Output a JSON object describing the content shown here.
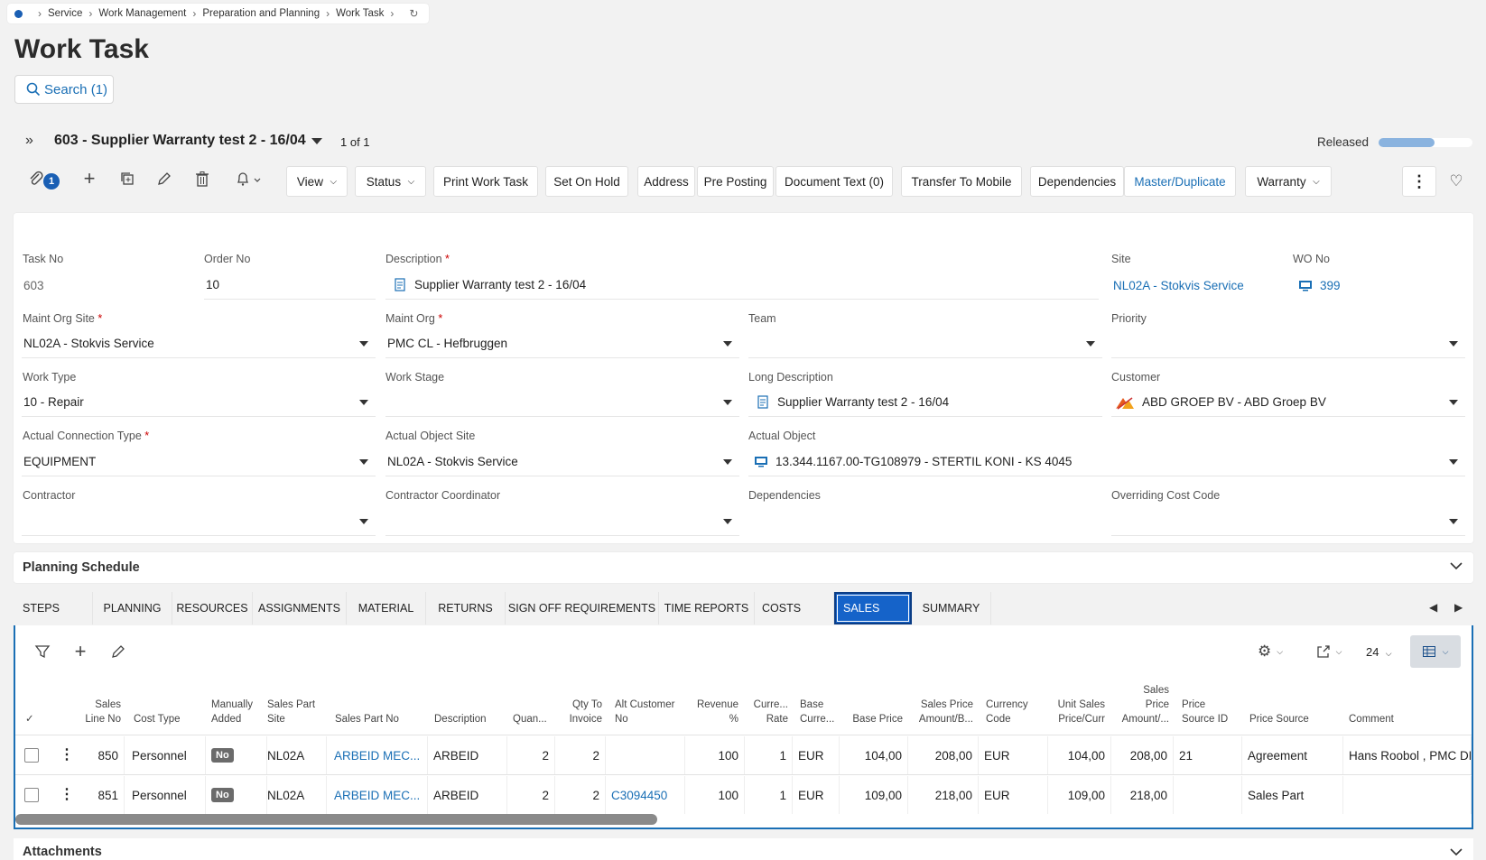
{
  "breadcrumb": [
    "Service",
    "Work Management",
    "Preparation and Planning",
    "Work Task"
  ],
  "page_title": "Work Task",
  "search_label": "Search (1)",
  "record": {
    "title": "603 - Supplier Warranty test 2 - 16/04",
    "count": "1 of 1",
    "status": "Released",
    "status_progress": 0.6
  },
  "toolbar": {
    "attachments_count": "1",
    "view": "View",
    "status": "Status",
    "print": "Print Work Task",
    "hold": "Set On Hold",
    "address": "Address",
    "pre_posting": "Pre Posting",
    "document_text": "Document Text (0)",
    "transfer": "Transfer To Mobile",
    "dependencies": "Dependencies",
    "master": "Master/Duplicate",
    "warranty": "Warranty"
  },
  "form": {
    "task_no": {
      "label": "Task No",
      "value": "603"
    },
    "order_no": {
      "label": "Order No",
      "value": "10"
    },
    "description": {
      "label": "Description",
      "value": "Supplier Warranty test 2 - 16/04"
    },
    "site": {
      "label": "Site",
      "value": "NL02A - Stokvis Service"
    },
    "wo_no": {
      "label": "WO No",
      "value": "399"
    },
    "maint_org_site": {
      "label": "Maint Org Site",
      "value": "NL02A - Stokvis Service"
    },
    "maint_org": {
      "label": "Maint Org",
      "value": "PMC CL - Hefbruggen"
    },
    "team": {
      "label": "Team",
      "value": ""
    },
    "priority": {
      "label": "Priority",
      "value": ""
    },
    "work_type": {
      "label": "Work Type",
      "value": "10 - Repair"
    },
    "work_stage": {
      "label": "Work Stage",
      "value": ""
    },
    "long_description": {
      "label": "Long Description",
      "value": "Supplier Warranty test 2 - 16/04"
    },
    "customer": {
      "label": "Customer",
      "value": "ABD GROEP BV - ABD Groep BV"
    },
    "actual_connection_type": {
      "label": "Actual Connection Type",
      "value": "EQUIPMENT"
    },
    "actual_object_site": {
      "label": "Actual Object Site",
      "value": "NL02A - Stokvis Service"
    },
    "actual_object": {
      "label": "Actual Object",
      "value": "13.344.1167.00-TG108979 - STERTIL KONI - KS 4045"
    },
    "contractor": {
      "label": "Contractor",
      "value": ""
    },
    "contractor_coordinator": {
      "label": "Contractor Coordinator",
      "value": ""
    },
    "dependencies": {
      "label": "Dependencies",
      "value": ""
    },
    "overriding_cost_code": {
      "label": "Overriding Cost Code",
      "value": ""
    }
  },
  "planning_schedule": "Planning Schedule",
  "tabs": [
    "STEPS",
    "PLANNING",
    "RESOURCES",
    "ASSIGNMENTS",
    "MATERIAL",
    "RETURNS",
    "SIGN OFF REQUIREMENTS",
    "TIME REPORTS",
    "COSTS",
    "SALES",
    "SUMMARY"
  ],
  "active_tab": "SALES",
  "grid": {
    "page_size": "24",
    "columns": [
      "Sales Line No",
      "Cost Type",
      "Manually Added",
      "Sales Part Site",
      "Sales Part No",
      "Description",
      "Quan...",
      "Qty To Invoice",
      "Alt Customer No",
      "Revenue %",
      "Curre... Rate",
      "Base Curre...",
      "Base Price",
      "Sales Price Amount/B...",
      "Currency Code",
      "Unit Sales Price/Curr",
      "Sales Price Amount/...",
      "Price Source ID",
      "Price Source",
      "Comment"
    ],
    "rows": [
      [
        "850",
        "Personnel",
        "No",
        "NL02A",
        "ARBEID MEC...",
        "ARBEID",
        "2",
        "2",
        "",
        "100",
        "1",
        "EUR",
        "104,00",
        "208,00",
        "EUR",
        "104,00",
        "208,00",
        "21",
        "Agreement",
        "Hans Roobol , PMC DD"
      ],
      [
        "851",
        "Personnel",
        "No",
        "NL02A",
        "ARBEID MEC...",
        "ARBEID",
        "2",
        "2",
        "C3094450",
        "100",
        "1",
        "EUR",
        "109,00",
        "218,00",
        "EUR",
        "109,00",
        "218,00",
        "",
        "Sales Part",
        ""
      ]
    ]
  },
  "attachments": "Attachments"
}
